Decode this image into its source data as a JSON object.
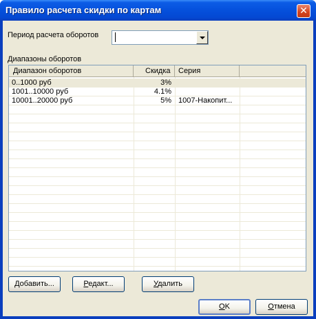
{
  "window": {
    "title": "Правило расчета скидки по картам",
    "close_glyph": "✕"
  },
  "period": {
    "label": "Период расчета оборотов",
    "value": ""
  },
  "ranges": {
    "label": "Диапазоны оборотов",
    "columns": [
      "Диапазон оборотов",
      "Скидка",
      "Серия"
    ],
    "rows": [
      [
        "0..1000 руб",
        "3%",
        ""
      ],
      [
        "1001..10000 руб",
        "4.1%",
        ""
      ],
      [
        "10001..20000 руб",
        "5%",
        "1007-Накопит..."
      ]
    ]
  },
  "buttons": {
    "add": {
      "mnemonic": "Д",
      "rest": "обавить..."
    },
    "edit": {
      "mnemonic": "Р",
      "rest": "едакт..."
    },
    "delete": {
      "mnemonic": "У",
      "rest": "далить"
    },
    "ok": {
      "mnemonic": "O",
      "rest": "K"
    },
    "cancel": {
      "mnemonic": "О",
      "rest": "тмена"
    }
  }
}
